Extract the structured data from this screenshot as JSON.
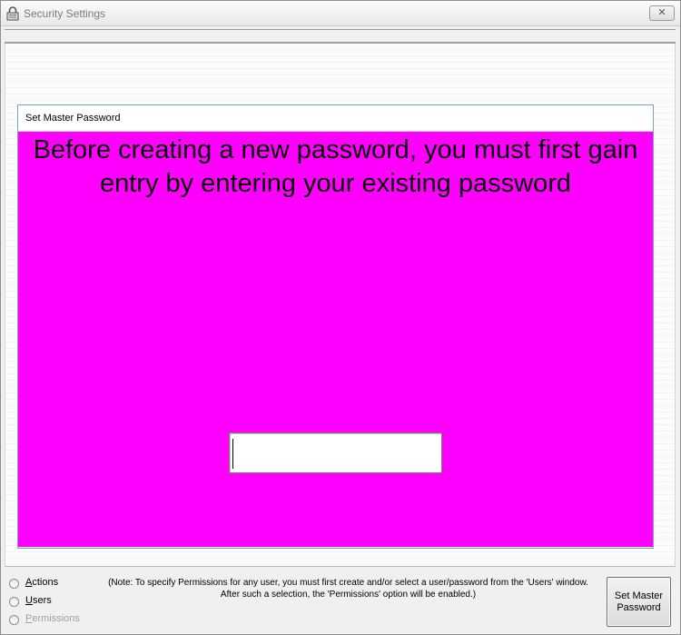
{
  "window": {
    "title": "Security Settings",
    "close_label": "✕"
  },
  "panel": {
    "title": "Set Master Password",
    "message": "Before creating a new password, you must first gain entry by entering your existing password",
    "password_value": ""
  },
  "options": [
    {
      "label_key": "A",
      "label_rest": "ctions",
      "selected": false,
      "enabled": true
    },
    {
      "label_key": "U",
      "label_rest": "sers",
      "selected": false,
      "enabled": true
    },
    {
      "label_key": "P",
      "label_rest": "ermissions",
      "selected": false,
      "enabled": false
    }
  ],
  "note": "(Note: To specify Permissions for any user, you must first create and/or select a user/password from the 'Users' window.  After such a selection, the 'Permissions' option will be enabled.)",
  "buttons": {
    "set_master_line1": "Set Master",
    "set_master_line2": "Password"
  },
  "colors": {
    "panel_background": "#ff00ff",
    "panel_border": "#7aa0c8"
  },
  "icons": {
    "title_icon": "lock-icon",
    "close_icon": "close-icon"
  }
}
